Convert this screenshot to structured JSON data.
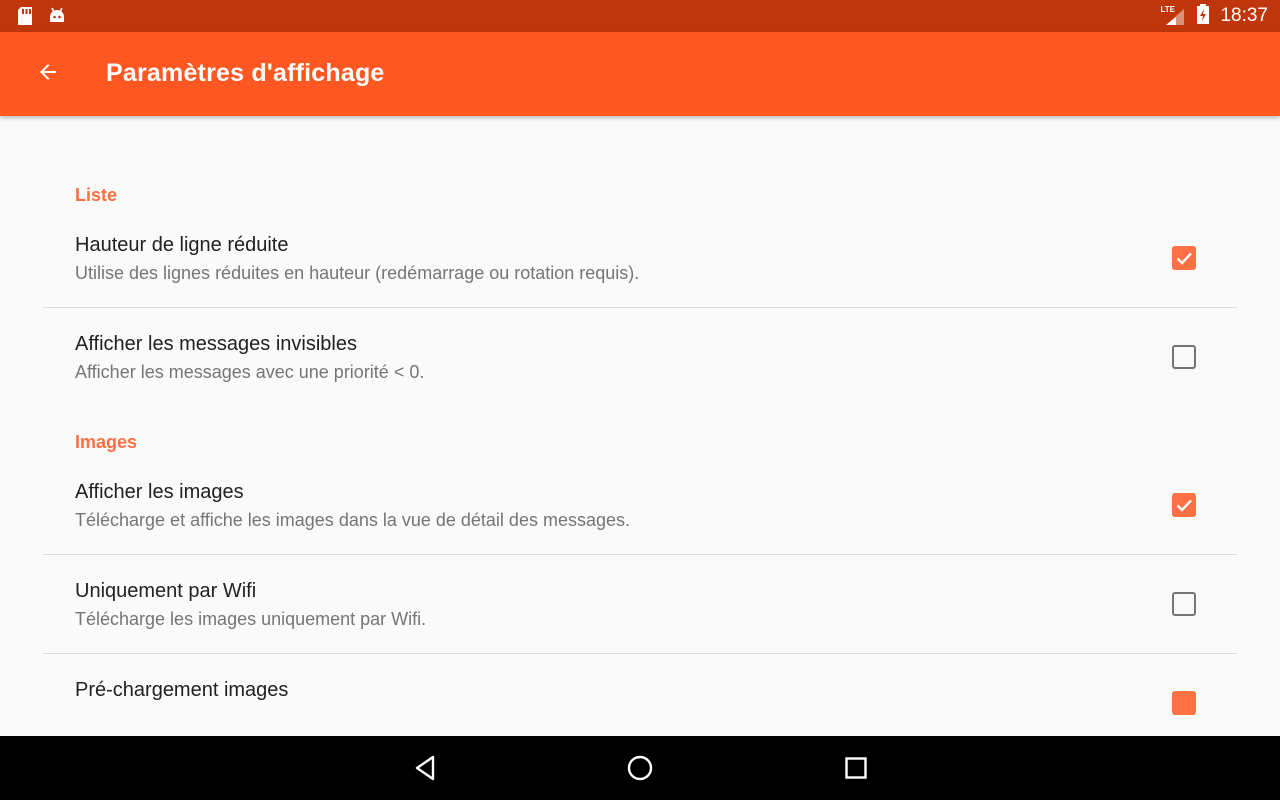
{
  "status_bar": {
    "time": "18:37",
    "network_label": "LTE",
    "icons": [
      "sd-card-icon",
      "android-icon",
      "signal-icon",
      "battery-icon"
    ]
  },
  "app_bar": {
    "title": "Paramètres d'affichage",
    "back_icon": "arrow-back-icon"
  },
  "sections": [
    {
      "header": "Liste",
      "items": [
        {
          "title": "Hauteur de ligne réduite",
          "summary": "Utilise des lignes réduites en hauteur (redémarrage ou rotation requis).",
          "checked": true
        },
        {
          "title": "Afficher les messages invisibles",
          "summary": "Afficher les messages avec une priorité < 0.",
          "checked": false
        }
      ]
    },
    {
      "header": "Images",
      "items": [
        {
          "title": "Afficher les images",
          "summary": "Télécharge et affiche les images dans la vue de détail des messages.",
          "checked": true
        },
        {
          "title": "Uniquement par Wifi",
          "summary": "Télécharge les images uniquement par Wifi.",
          "checked": false
        },
        {
          "title": "Pré-chargement images",
          "summary": "",
          "checked": true
        }
      ]
    }
  ],
  "nav_bar": {
    "icons": [
      "back-triangle-icon",
      "home-circle-icon",
      "recents-square-icon"
    ]
  },
  "colors": {
    "status_bar": "#bf360c",
    "app_bar": "#ff5722",
    "accent": "#ff7043",
    "background": "#fafafa"
  }
}
